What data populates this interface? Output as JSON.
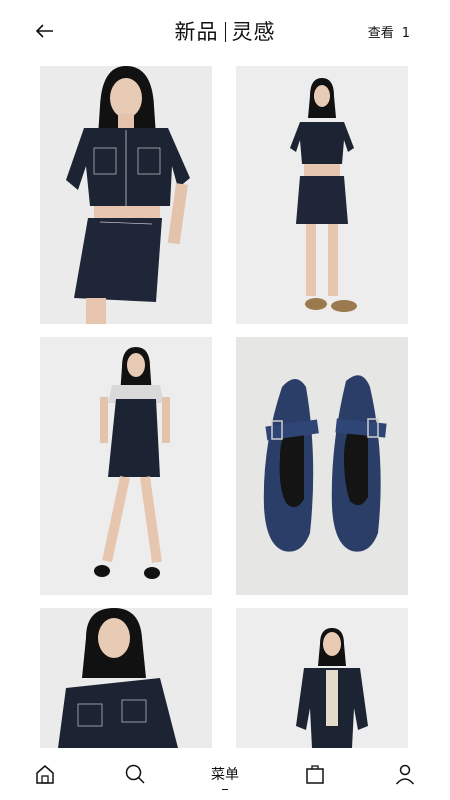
{
  "header": {
    "title_left": "新品",
    "title_right": "灵感",
    "view_label": "查看",
    "view_count": "1"
  },
  "products": [
    {
      "name": "denim-cropped-shirt-and-skirt-closeup"
    },
    {
      "name": "denim-cropped-shirt-and-skirt-full"
    },
    {
      "name": "denim-pinafore-dress"
    },
    {
      "name": "denim-mary-jane-flats"
    },
    {
      "name": "denim-jacket-closeup"
    },
    {
      "name": "denim-jacket-full"
    }
  ],
  "nav": {
    "menu_label": "菜单",
    "items": [
      "home-icon",
      "search-icon",
      "menu",
      "shopping-bag-icon",
      "user-icon"
    ]
  },
  "colors": {
    "denim": "#1c2433",
    "denim_light": "#2a3e68",
    "background": "#ffffff",
    "text": "#111111"
  }
}
